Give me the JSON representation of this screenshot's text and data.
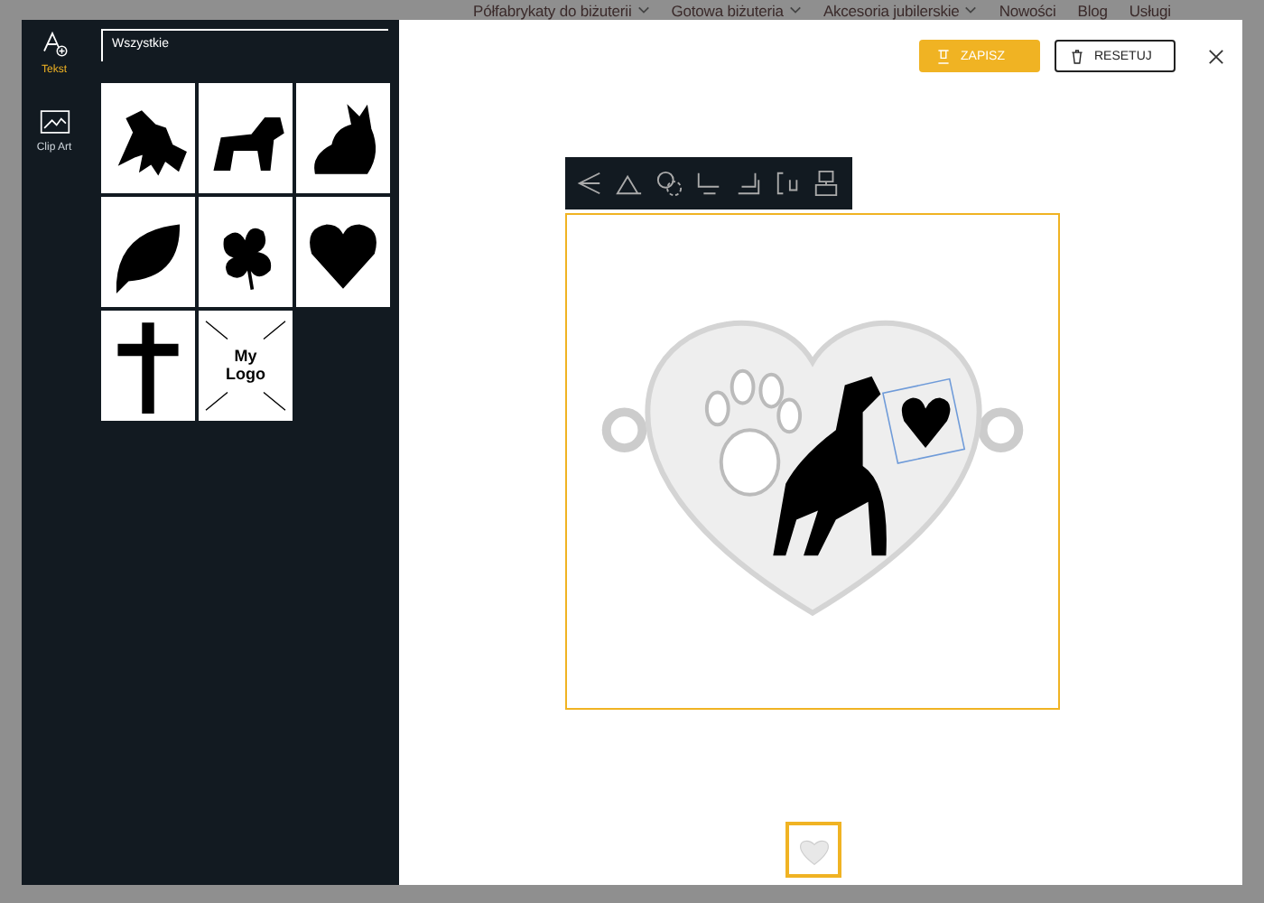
{
  "site_nav": [
    {
      "label": "Półfabrykaty do biżuterii",
      "dropdown": true
    },
    {
      "label": "Gotowa biżuteria",
      "dropdown": true
    },
    {
      "label": "Akcesoria jubilerskie",
      "dropdown": true
    },
    {
      "label": "Nowości",
      "dropdown": false
    },
    {
      "label": "Blog",
      "dropdown": false
    },
    {
      "label": "Usługi",
      "dropdown": false
    }
  ],
  "rail": [
    {
      "kind": "text",
      "label": "Tekst",
      "selected": true
    },
    {
      "kind": "clipart",
      "label": "Clip Art",
      "selected": false
    }
  ],
  "category_select": {
    "value": "Wszystkie"
  },
  "clipart": [
    {
      "kind": "image"
    },
    {
      "kind": "image"
    },
    {
      "kind": "image"
    },
    {
      "kind": "image"
    },
    {
      "kind": "image"
    },
    {
      "kind": "image"
    },
    {
      "kind": "image"
    },
    {
      "kind": "logo",
      "label": "My Logo"
    }
  ],
  "buttons": {
    "save": "ZAPISZ",
    "reset": "RESETUJ"
  },
  "thumbnails": [
    {
      "selected": true
    }
  ]
}
